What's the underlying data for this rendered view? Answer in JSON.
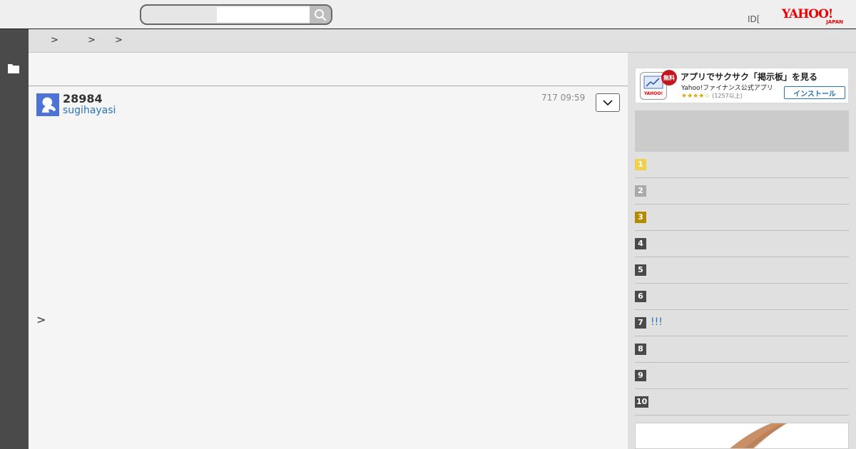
{
  "header": {
    "search_placeholder": "",
    "id_text": "ID[",
    "logo_text": "YAHOO!",
    "logo_sub": "JAPAN"
  },
  "breadcrumb": {
    "separators": [
      ">",
      ">",
      ">"
    ]
  },
  "post": {
    "number": "28984",
    "username": "sugihayasi",
    "date": "717 09:59",
    "quote_mark": ">"
  },
  "app_banner": {
    "badge": "無料",
    "title": "アプリでサクサク「掲示板」を見る",
    "subtitle": "Yahoo!ファイナンス公式アプリ",
    "stars": "★★★★☆",
    "review_count": "(1257以上)",
    "install_label": "インストール"
  },
  "ranking": {
    "items": [
      {
        "rank": "1",
        "title": "",
        "color": "#f0d04c"
      },
      {
        "rank": "2",
        "title": "",
        "color": "#aaaaaa"
      },
      {
        "rank": "3",
        "title": "",
        "color": "#b48a00"
      },
      {
        "rank": "4",
        "title": "",
        "color": "#4a4a4a"
      },
      {
        "rank": "5",
        "title": "",
        "color": "#4a4a4a"
      },
      {
        "rank": "6",
        "title": "",
        "color": "#4a4a4a"
      },
      {
        "rank": "7",
        "title": "!!!",
        "color": "#4a4a4a"
      },
      {
        "rank": "8",
        "title": "",
        "color": "#4a4a4a"
      },
      {
        "rank": "9",
        "title": "",
        "color": "#4a4a4a"
      },
      {
        "rank": "10",
        "title": "",
        "color": "#4a4a4a"
      }
    ]
  },
  "colors": {
    "brand_red": "#ee0000",
    "link_blue": "#2a74b8",
    "left_bar": "#4a4a4a"
  }
}
